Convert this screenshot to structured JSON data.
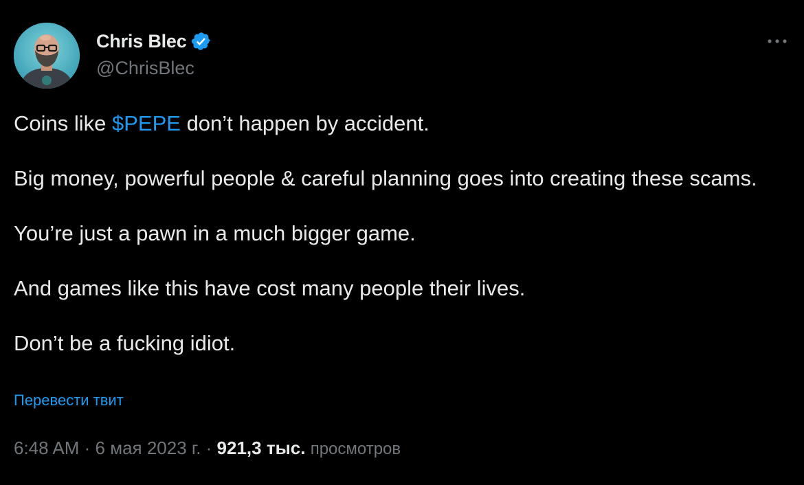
{
  "author": {
    "display_name": "Chris Blec",
    "handle": "@ChrisBlec",
    "verified": true,
    "avatar_icon": "user-avatar"
  },
  "more_icon": "more-horizontal-icon",
  "tweet": {
    "paragraphs": [
      {
        "prefix": "Coins like ",
        "cashtag": "$PEPE",
        "suffix": " don’t happen by accident."
      },
      "Big money, powerful people & careful planning goes into creating these scams.",
      "You’re just a pawn in a much bigger game.",
      "And games like this have cost many people their lives.",
      "Don’t be a fucking idiot."
    ]
  },
  "translate_label": "Перевести твит",
  "meta": {
    "time": "6:48 AM",
    "separator": " · ",
    "date": "6 мая 2023 г.",
    "views_count": "921,3 тыс.",
    "views_label": "просмотров"
  },
  "colors": {
    "background": "#000000",
    "text": "#e7e9ea",
    "secondary": "#71767b",
    "accent": "#1d9bf0"
  }
}
